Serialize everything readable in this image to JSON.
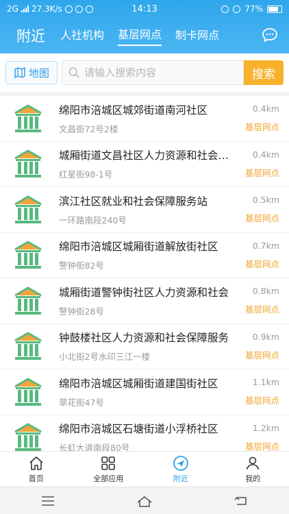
{
  "status_bar": {
    "network": "2G",
    "speed": "27.3K/s",
    "time": "14:13",
    "battery": "77%"
  },
  "header": {
    "title": "附近",
    "tabs": [
      {
        "label": "人社机构"
      },
      {
        "label": "基层网点"
      },
      {
        "label": "制卡网点"
      }
    ],
    "active_tab": "基层网点",
    "accent_color": "#2fa6ec"
  },
  "search": {
    "map_label": "地图",
    "placeholder": "请输入搜索内容",
    "button_label": "搜索",
    "button_color": "#f7b12d"
  },
  "list": {
    "items": [
      {
        "name": "绵阳市涪城区城郊街道南河社区",
        "address": "文昌街72号2楼",
        "distance": "0.4km",
        "tag": "基层网点"
      },
      {
        "name": "城厢街道文昌社区人力资源和社会保障",
        "address": "红星街98-1号",
        "distance": "0.4km",
        "tag": "基层网点"
      },
      {
        "name": "滨江社区就业和社会保障服务站",
        "address": "一环路南段240号",
        "distance": "0.5km",
        "tag": "基层网点"
      },
      {
        "name": "绵阳市涪城区城厢街道解放街社区",
        "address": "警钟街82号",
        "distance": "0.7km",
        "tag": "基层网点"
      },
      {
        "name": "城厢街道警钟街社区人力资源和社会",
        "address": "警钟街28号",
        "distance": "0.8km",
        "tag": "基层网点"
      },
      {
        "name": "钟鼓楼社区人力资源和社会保障服务",
        "address": "小北街2号水印三江一楼",
        "distance": "0.9km",
        "tag": "基层网点"
      },
      {
        "name": "绵阳市涪城区城厢街道建国街社区",
        "address": "翠花街47号",
        "distance": "1.1km",
        "tag": "基层网点"
      },
      {
        "name": "绵阳市涪城区石塘街道小浮桥社区",
        "address": "长虹大道南段80号",
        "distance": "1.2km",
        "tag": "基层网点"
      }
    ]
  },
  "tabbar": {
    "tabs": [
      {
        "label": "首页"
      },
      {
        "label": "全部应用"
      },
      {
        "label": "附近"
      },
      {
        "label": "我的"
      }
    ],
    "active": "附近"
  }
}
